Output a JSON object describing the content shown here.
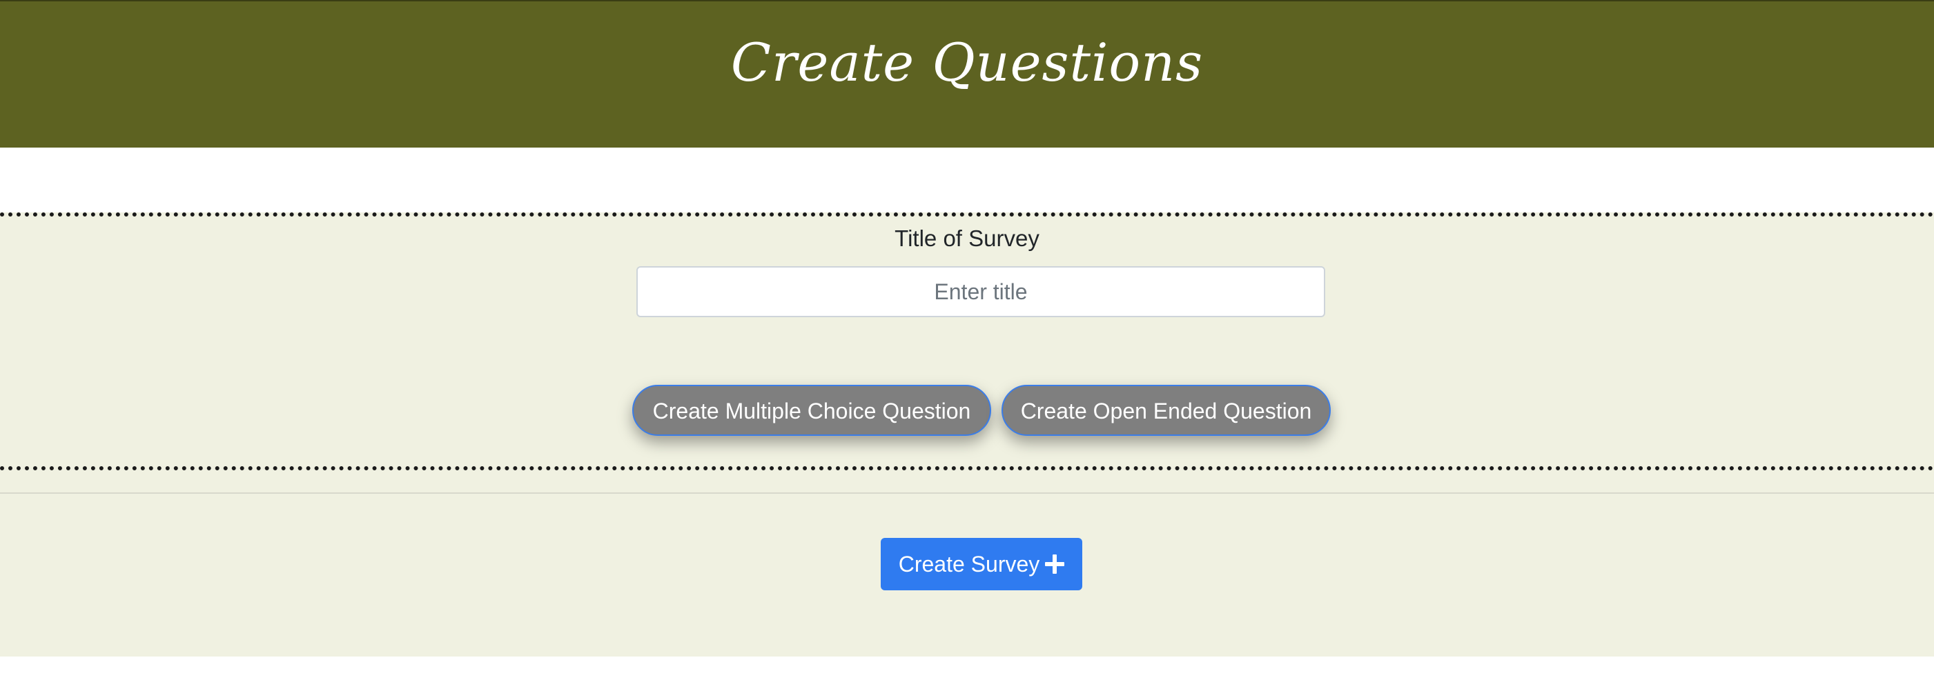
{
  "header": {
    "title": "Create Questions"
  },
  "survey_form": {
    "title_label": "Title of Survey",
    "title_input": {
      "value": "",
      "placeholder": "Enter title"
    },
    "buttons": {
      "multiple_choice": "Create Multiple Choice Question",
      "open_ended": "Create Open Ended Question"
    }
  },
  "footer_actions": {
    "create_survey_label": "Create Survey",
    "create_survey_icon": "plus-icon"
  },
  "colors": {
    "header_bg": "#5d6221",
    "section_bg": "#f0f1e1",
    "question_button_bg": "#7f7f7f",
    "question_button_border": "#3b7de8",
    "primary_button_bg": "#2f7bf0"
  }
}
